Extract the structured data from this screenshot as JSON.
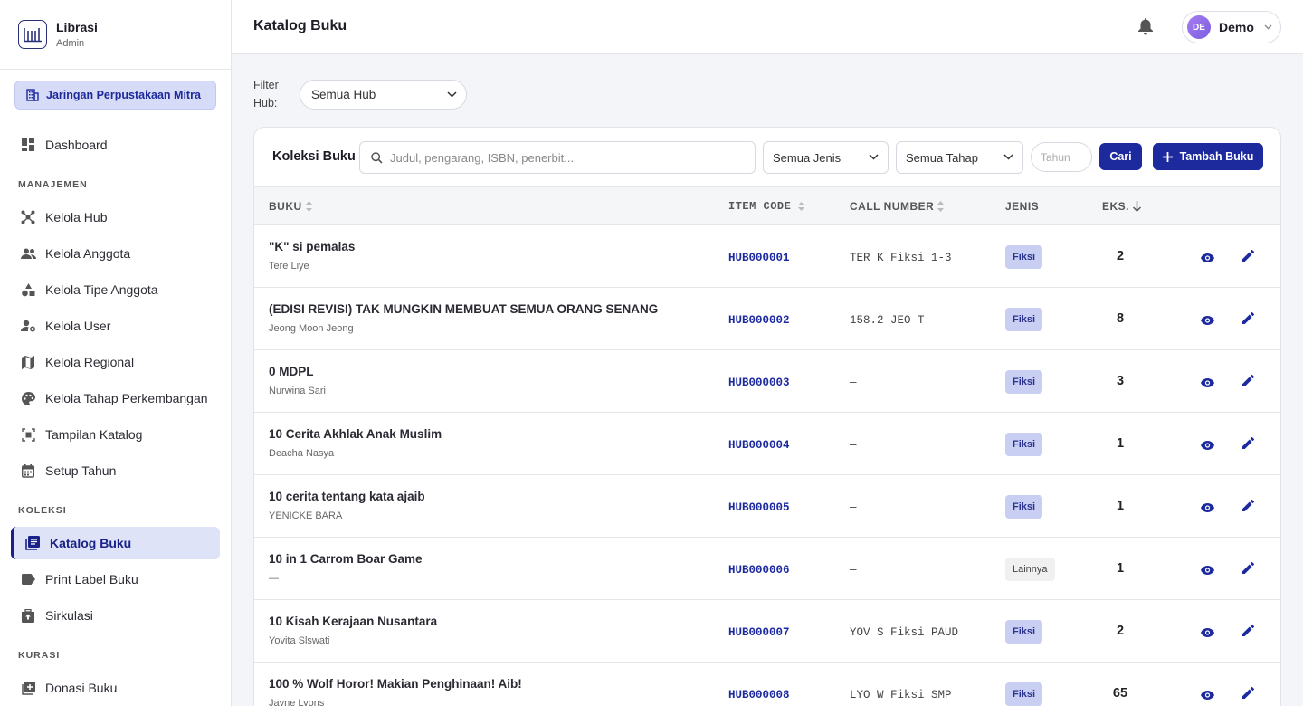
{
  "brand": {
    "title": "Librasi",
    "subtitle": "Admin"
  },
  "network_button": "Jaringan Perpustakaan Mitra",
  "nav": {
    "dashboard": "Dashboard",
    "section_manajemen": "MANAJEMEN",
    "kelola_hub": "Kelola Hub",
    "kelola_anggota": "Kelola Anggota",
    "kelola_tipe_anggota": "Kelola Tipe Anggota",
    "kelola_user": "Kelola User",
    "kelola_regional": "Kelola Regional",
    "kelola_tahap": "Kelola Tahap Perkembangan",
    "tampilan_katalog": "Tampilan Katalog",
    "setup_tahun": "Setup Tahun",
    "section_koleksi": "KOLEKSI",
    "katalog_buku": "Katalog Buku",
    "print_label": "Print Label Buku",
    "sirkulasi": "Sirkulasi",
    "section_kurasi": "KURASI",
    "donasi_buku": "Donasi Buku"
  },
  "header": {
    "title": "Katalog Buku",
    "user_initials": "DE",
    "user_name": "Demo"
  },
  "filter": {
    "label": "Filter Hub:",
    "value": "Semua Hub"
  },
  "card": {
    "title": "Koleksi Buku",
    "search_placeholder": "Judul, pengarang, ISBN, penerbit...",
    "jenis_value": "Semua Jenis",
    "tahap_value": "Semua Tahap",
    "year_placeholder": "Tahun",
    "search_button": "Cari",
    "add_button": "Tambah Buku"
  },
  "columns": {
    "buku": "BUKU",
    "item_code": "ITEM CODE",
    "call_number": "CALL NUMBER",
    "jenis": "JENIS",
    "eks": "EKS."
  },
  "rows": [
    {
      "title": "\"K\" si pemalas",
      "author": "Tere Liye",
      "code": "HUB000001",
      "call": "TER K Fiksi 1-3",
      "jenis": "Fiksi",
      "eks": "2"
    },
    {
      "title": "(EDISI REVISI) TAK MUNGKIN MEMBUAT SEMUA ORANG SENANG",
      "author": "Jeong Moon Jeong",
      "code": "HUB000002",
      "call": "158.2 JEO T",
      "jenis": "Fiksi",
      "eks": "8"
    },
    {
      "title": "0 MDPL",
      "author": "Nurwina Sari",
      "code": "HUB000003",
      "call": "—",
      "jenis": "Fiksi",
      "eks": "3"
    },
    {
      "title": "10 Cerita Akhlak Anak Muslim",
      "author": "Deacha Nasya",
      "code": "HUB000004",
      "call": "—",
      "jenis": "Fiksi",
      "eks": "1"
    },
    {
      "title": "10 cerita tentang kata ajaib",
      "author": "YENICKE BARA",
      "code": "HUB000005",
      "call": "—",
      "jenis": "Fiksi",
      "eks": "1"
    },
    {
      "title": "10 in 1 Carrom Boar Game",
      "author": "—",
      "code": "HUB000006",
      "call": "—",
      "jenis": "Lainnya",
      "eks": "1"
    },
    {
      "title": "10 Kisah Kerajaan Nusantara",
      "author": "Yovita Slswati",
      "code": "HUB000007",
      "call": "YOV S Fiksi PAUD",
      "jenis": "Fiksi",
      "eks": "2"
    },
    {
      "title": "100 % Wolf Horor! Makian Penghinaan! Aib!",
      "author": "Jayne Lyons",
      "code": "HUB000008",
      "call": "LYO W Fiksi SMP",
      "jenis": "Fiksi",
      "eks": "65"
    }
  ],
  "colors": {
    "primary": "#1c2a9e",
    "active_bg": "#dfe3f8",
    "badge_fiksi": "#c9cff2"
  }
}
